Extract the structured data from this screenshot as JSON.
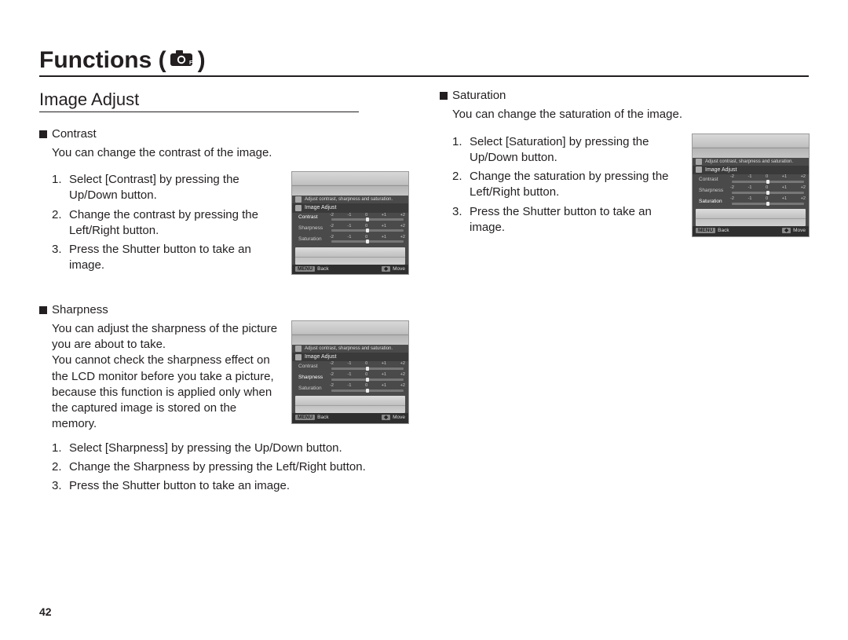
{
  "chapter": {
    "title_prefix": "Functions (",
    "title_suffix": " )"
  },
  "section": {
    "title": "Image Adjust"
  },
  "page_number": "42",
  "lcd": {
    "hint": "Adjust contrast, sharpness and saturation.",
    "header": "Image Adjust",
    "labels": {
      "contrast": "Contrast",
      "sharpness": "Sharpness",
      "saturation": "Saturation"
    },
    "ticks": [
      "-2",
      "-1",
      "0",
      "+1",
      "+2"
    ],
    "back_key": "MENU",
    "back_label": "Back",
    "move_key": "◆",
    "move_label": "Move"
  },
  "contrast": {
    "title": "Contrast",
    "desc": "You can change the contrast of the image.",
    "steps": [
      "Select [Contrast] by pressing the Up/Down button.",
      "Change the contrast by pressing the Left/Right button.",
      "Press the Shutter button to take an image."
    ]
  },
  "sharpness": {
    "title": "Sharpness",
    "desc": "You can adjust the sharpness of the picture you are about to take.",
    "note": "You cannot check the sharpness effect on the LCD monitor before you take a picture, because this function is applied only when the captured image is stored on the memory.",
    "steps": [
      "Select [Sharpness] by pressing the Up/Down button.",
      "Change the Sharpness by pressing the Left/Right button.",
      "Press the Shutter button to take an image."
    ]
  },
  "saturation": {
    "title": "Saturation",
    "desc": "You can change the saturation of the image.",
    "steps": [
      "Select [Saturation] by pressing the Up/Down button.",
      "Change the saturation by pressing the Left/Right button.",
      "Press the Shutter button to take an image."
    ]
  }
}
